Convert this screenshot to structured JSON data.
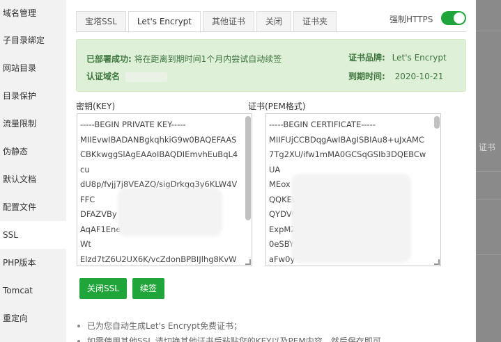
{
  "sidebar": {
    "items": [
      {
        "label": "域名管理"
      },
      {
        "label": "子目录绑定"
      },
      {
        "label": "网站目录"
      },
      {
        "label": "目录保护"
      },
      {
        "label": "流量限制"
      },
      {
        "label": "伪静态"
      },
      {
        "label": "默认文档"
      },
      {
        "label": "配置文件"
      },
      {
        "label": "SSL",
        "active": true
      },
      {
        "label": "PHP版本"
      },
      {
        "label": "Tomcat"
      },
      {
        "label": "重定向"
      }
    ]
  },
  "tabs": [
    {
      "label": "宝塔SSL"
    },
    {
      "label": "Let's Encrypt",
      "active": true
    },
    {
      "label": "其他证书"
    },
    {
      "label": "关闭"
    },
    {
      "label": "证书夹"
    }
  ],
  "https_toggle": {
    "label": "强制HTTPS",
    "on": true
  },
  "status": {
    "deployed_label": "已部署成功:",
    "deployed_text": "将在距离到期时间1个月内尝试自动续签",
    "domain_label": "认证域名",
    "brand_label": "证书品牌:",
    "brand_value": "Let's Encrypt",
    "expiry_label": "到期时间:",
    "expiry_value": "2020-10-21"
  },
  "key_field": {
    "label": "密钥(KEY)",
    "value": "-----BEGIN PRIVATE KEY-----\nMIIEvwIBADANBgkqhkiG9w0BAQEFAAS\nCBKkwggSlAgEAAoIBAQDIEmvhEuBqL4\ncu\ndU8p/fvjj7j8VEAZQ/sigDrkgq3y6KLW4V\nFFC\nDFAZVBy\nAqAF1Ene+8UnC\nWt\nElzd7tZ6U2UX6K/vcZdonBPBIJlhg8KvW"
  },
  "cert_field": {
    "label": "证书(PEM格式)",
    "value": "-----BEGIN CERTIFICATE-----\nMIIFUjCCBDqgAwIBAgISBIAu8+uJxAMC\n7Tg2XU/ifw1mMA0GCSqGSIb3DQEBCw\nUA\nMEox\nQQKEw\nQYDVQQ\nExpMZXQn\n0eSBYMzAeFw0\naFw0y"
  },
  "buttons": {
    "close_ssl": "关闭SSL",
    "renew": "续签"
  },
  "notes": [
    "已为您自动生成Let's Encrypt免费证书；",
    "如需使用其他SSL,请切换其他证书后粘贴您的KEY以及PEM内容，然后保存即可。"
  ],
  "backdrop": {
    "label": "证书"
  },
  "colors": {
    "accent": "#20a53a",
    "success_bg": "#dff0d8",
    "success_text": "#3c763d"
  }
}
